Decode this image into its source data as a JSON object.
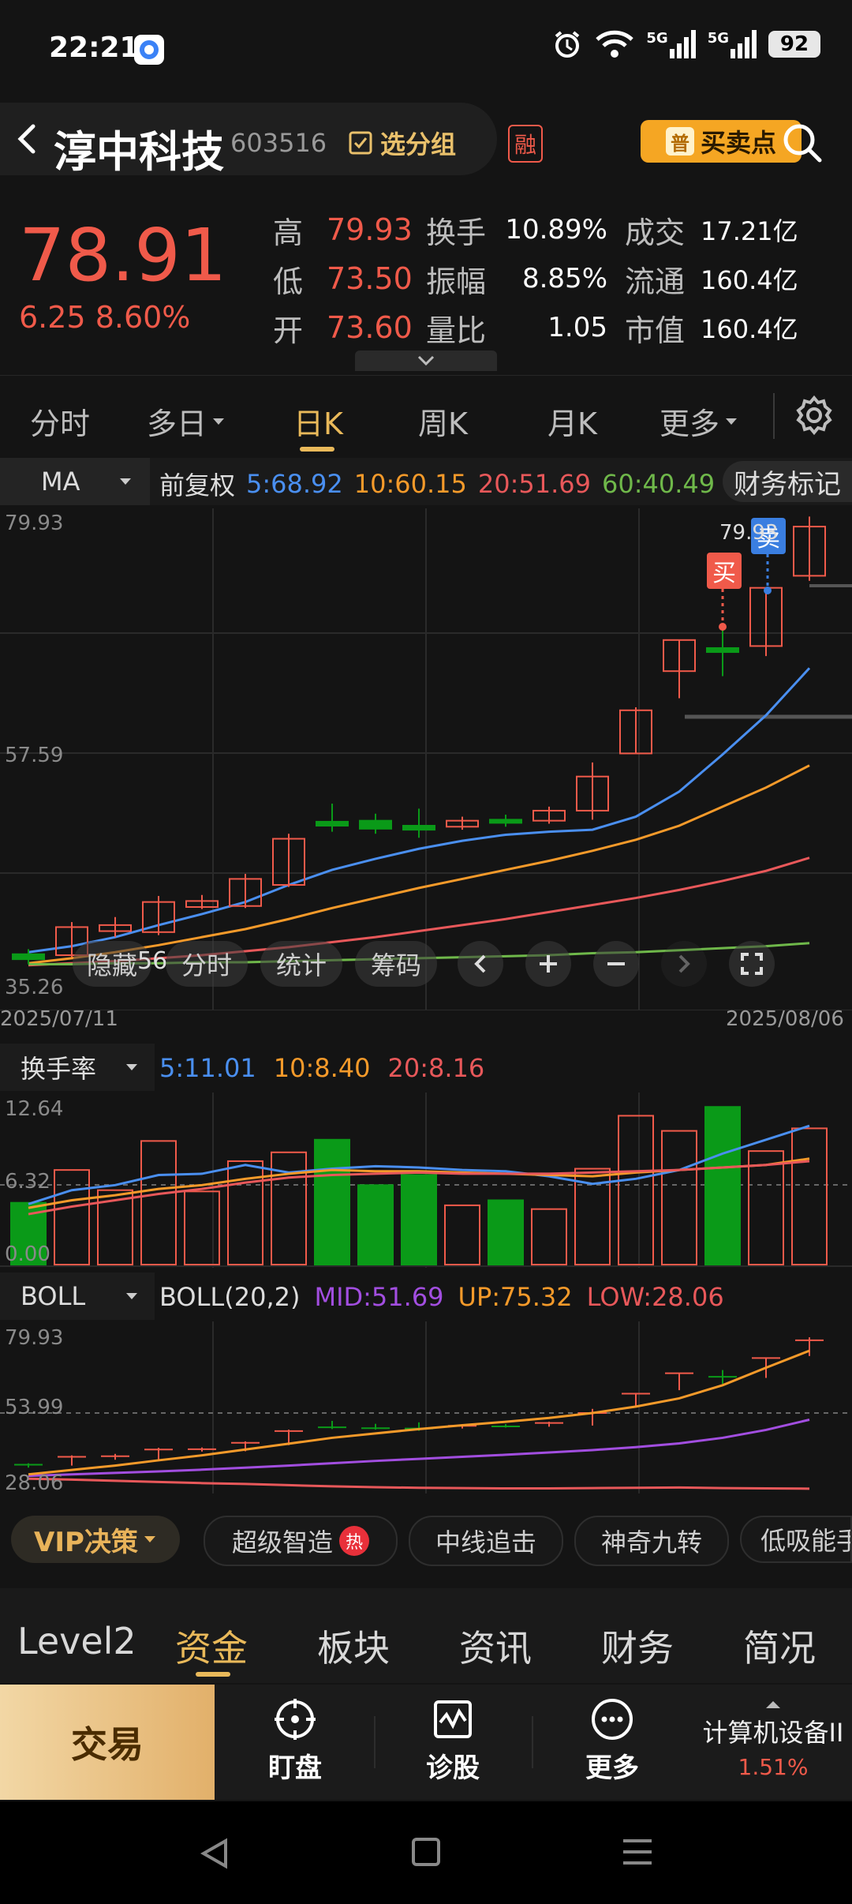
{
  "status_bar": {
    "time": "22:21",
    "network_1": "5G",
    "network_2": "5G",
    "battery": "92"
  },
  "header": {
    "stock_name": "淳中科技",
    "stock_code": "603516",
    "group_label": "选分组",
    "margin_tag": "融",
    "signal_btn_icon_text": "普",
    "signal_btn_label": "买卖点"
  },
  "quote": {
    "price": "78.91",
    "change": "6.25 8.60%",
    "rows": [
      {
        "k1": "高",
        "v1": "79.93",
        "k2": "换手",
        "v2": "10.89%",
        "k3": "成交",
        "v3": "17.21亿"
      },
      {
        "k1": "低",
        "v1": "73.50",
        "k2": "振幅",
        "v2": "8.85%",
        "k3": "流通",
        "v3": "160.4亿"
      },
      {
        "k1": "开",
        "v1": "73.60",
        "k2": "量比",
        "v2": "1.05",
        "k3": "市值",
        "v3": "160.4亿"
      }
    ]
  },
  "period_tabs": [
    {
      "label": "分时"
    },
    {
      "label": "多日"
    },
    {
      "label": "日K",
      "active": true
    },
    {
      "label": "周K"
    },
    {
      "label": "月K"
    },
    {
      "label": "更多"
    }
  ],
  "ma_bar": {
    "indicator": "MA",
    "adjust": "前复权",
    "ma5": "5:68.92",
    "ma10": "10:60.15",
    "ma20": "20:51.69",
    "ma60": "60:40.49",
    "finance_mark": "财务标记"
  },
  "colors": {
    "up": "#f05a4a",
    "down": "#0a9a18",
    "ma5": "#4a8ff0",
    "ma10": "#f59a2a",
    "ma20": "#e8585a",
    "ma60": "#6fb84a",
    "mid": "#a24ee0",
    "accent": "#e9b95a"
  },
  "kline": {
    "y_labels": {
      "top": "79.93",
      "mid": "57.59",
      "bottom": "35.26"
    },
    "date_start": "2025/07/11",
    "date_end": "2025/08/06",
    "buy_tag": "买",
    "sell_tag": "卖",
    "high_label": "79.93",
    "controls": {
      "hide": "隐藏",
      "period_num": "56",
      "intraday": "分时",
      "stats": "统计",
      "chips": "筹码"
    }
  },
  "turnover": {
    "indicator": "换手率",
    "ma5": "5:11.01",
    "ma10": "10:8.40",
    "ma20": "20:8.16",
    "y_labels": {
      "top": "12.64",
      "mid": "6.32",
      "bottom": "0.00"
    }
  },
  "boll": {
    "indicator": "BOLL",
    "params": "BOLL(20,2)",
    "mid": "MID:51.69",
    "up": "UP:75.32",
    "low": "LOW:28.06",
    "y_labels": {
      "top": "79.93",
      "mid": "53.99",
      "bottom": "28.06"
    }
  },
  "strategies": {
    "vip": "VIP决策",
    "items": [
      "超级智造",
      "中线追击",
      "神奇九转",
      "低吸能手"
    ],
    "hot_tag": "热"
  },
  "bottom_tabs": [
    {
      "label": "Level2"
    },
    {
      "label": "资金",
      "active": true
    },
    {
      "label": "板块"
    },
    {
      "label": "资讯"
    },
    {
      "label": "财务"
    },
    {
      "label": "简况"
    }
  ],
  "actions": {
    "trade": "交易",
    "watch": "盯盘",
    "diagnose": "诊股",
    "more": "更多",
    "sector_name": "计算机设备II",
    "sector_pct": "1.51%"
  },
  "chart_data": [
    {
      "type": "candlestick",
      "title": "日K",
      "x_range": [
        "2025/07/11",
        "2025/08/06"
      ],
      "ylim": [
        35.26,
        79.93
      ],
      "candles": [
        {
          "o": 35.8,
          "c": 36.3,
          "h": 36.8,
          "l": 35.3,
          "dir": "down"
        },
        {
          "o": 36.2,
          "c": 39.0,
          "h": 39.5,
          "l": 36.0,
          "dir": "up"
        },
        {
          "o": 38.6,
          "c": 39.2,
          "h": 40.0,
          "l": 38.0,
          "dir": "up"
        },
        {
          "o": 38.5,
          "c": 41.5,
          "h": 42.1,
          "l": 38.2,
          "dir": "up"
        },
        {
          "o": 41.0,
          "c": 41.6,
          "h": 42.2,
          "l": 40.8,
          "dir": "up"
        },
        {
          "o": 41.1,
          "c": 43.8,
          "h": 44.3,
          "l": 40.9,
          "dir": "up"
        },
        {
          "o": 43.2,
          "c": 47.8,
          "h": 48.3,
          "l": 43.0,
          "dir": "up"
        },
        {
          "o": 49.5,
          "c": 49.1,
          "h": 51.3,
          "l": 48.5,
          "dir": "down"
        },
        {
          "o": 49.6,
          "c": 48.8,
          "h": 50.3,
          "l": 48.3,
          "dir": "down"
        },
        {
          "o": 49.1,
          "c": 48.7,
          "h": 50.8,
          "l": 47.9,
          "dir": "down"
        },
        {
          "o": 49.0,
          "c": 49.6,
          "h": 50.0,
          "l": 48.7,
          "dir": "up"
        },
        {
          "o": 49.7,
          "c": 49.4,
          "h": 50.2,
          "l": 49.0,
          "dir": "down"
        },
        {
          "o": 49.6,
          "c": 50.6,
          "h": 51.0,
          "l": 49.3,
          "dir": "up"
        },
        {
          "o": 50.6,
          "c": 54.0,
          "h": 55.4,
          "l": 49.7,
          "dir": "up"
        },
        {
          "o": 56.3,
          "c": 60.6,
          "h": 60.9,
          "l": 56.3,
          "dir": "up"
        },
        {
          "o": 64.5,
          "c": 67.6,
          "h": 67.6,
          "l": 61.8,
          "dir": "up"
        },
        {
          "o": 66.8,
          "c": 66.4,
          "h": 68.7,
          "l": 64.0,
          "dir": "down"
        },
        {
          "o": 67.0,
          "c": 72.8,
          "h": 72.8,
          "l": 66.0,
          "dir": "up"
        },
        {
          "o": 74.0,
          "c": 78.9,
          "h": 79.9,
          "l": 73.5,
          "dir": "up"
        }
      ],
      "series": [
        {
          "name": "MA5",
          "values": [
            36.5,
            37.1,
            38.0,
            39.2,
            40.3,
            41.5,
            43.2,
            44.7,
            45.8,
            46.8,
            47.6,
            48.2,
            48.5,
            48.7,
            50.0,
            52.5,
            56.2,
            60.1,
            64.8
          ]
        },
        {
          "name": "MA10",
          "values": [
            35.4,
            35.9,
            36.5,
            37.2,
            38.0,
            38.8,
            39.8,
            40.9,
            41.9,
            42.9,
            43.8,
            44.7,
            45.6,
            46.6,
            47.7,
            49.1,
            51.0,
            52.9,
            55.1
          ]
        },
        {
          "name": "MA20",
          "values": [
            35.2,
            35.4,
            35.6,
            35.9,
            36.2,
            36.6,
            37.0,
            37.5,
            38.0,
            38.6,
            39.2,
            39.8,
            40.5,
            41.2,
            41.9,
            42.7,
            43.6,
            44.6,
            45.9
          ]
        },
        {
          "name": "MA60",
          "values": [
            35.3,
            35.3,
            35.4,
            35.4,
            35.5,
            35.5,
            35.6,
            35.7,
            35.8,
            35.9,
            36.0,
            36.1,
            36.2,
            36.4,
            36.5,
            36.7,
            36.9,
            37.1,
            37.4
          ]
        }
      ]
    },
    {
      "type": "bar",
      "title": "换手率",
      "ylim": [
        0,
        12.64
      ],
      "values": [
        4.9,
        7.5,
        5.9,
        9.8,
        5.8,
        8.2,
        8.9,
        9.9,
        6.3,
        7.1,
        4.7,
        5.1,
        4.4,
        7.6,
        11.8,
        10.6,
        12.5,
        9.0,
        10.8
      ],
      "dirs": [
        "down",
        "up",
        "up",
        "up",
        "up",
        "up",
        "up",
        "down",
        "down",
        "down",
        "up",
        "down",
        "up",
        "up",
        "up",
        "up",
        "down",
        "up",
        "up"
      ],
      "series": [
        {
          "name": "5",
          "values": [
            4.8,
            5.9,
            6.3,
            7.1,
            7.2,
            7.9,
            7.3,
            7.6,
            7.8,
            7.7,
            7.5,
            7.4,
            7.0,
            6.4,
            6.8,
            7.5,
            8.8,
            9.9,
            11.0
          ]
        },
        {
          "name": "10",
          "values": [
            4.5,
            5.1,
            5.5,
            6.0,
            6.3,
            6.8,
            7.2,
            7.5,
            7.4,
            7.4,
            7.3,
            7.2,
            7.1,
            7.0,
            7.3,
            7.5,
            7.7,
            7.9,
            8.4
          ]
        },
        {
          "name": "20",
          "values": [
            4.0,
            4.6,
            5.1,
            5.6,
            6.0,
            6.5,
            6.9,
            7.1,
            7.2,
            7.3,
            7.2,
            7.2,
            7.2,
            7.3,
            7.4,
            7.5,
            7.7,
            7.9,
            8.2
          ]
        }
      ]
    },
    {
      "type": "line",
      "title": "BOLL(20,2)",
      "ylim": [
        28.06,
        79.93
      ],
      "series": [
        {
          "name": "MID",
          "values": [
            32.5,
            33.0,
            33.5,
            34.0,
            34.6,
            35.3,
            36.0,
            36.8,
            37.6,
            38.3,
            39.0,
            39.7,
            40.5,
            41.3,
            42.3,
            43.6,
            45.5,
            48.2,
            51.7
          ]
        },
        {
          "name": "UP",
          "values": [
            33.0,
            34.5,
            36.0,
            37.8,
            39.5,
            41.5,
            43.5,
            45.5,
            47.0,
            48.5,
            49.8,
            51.0,
            52.3,
            54.0,
            56.2,
            59.0,
            63.5,
            69.5,
            75.3
          ]
        },
        {
          "name": "LOW",
          "values": [
            31.5,
            31.2,
            30.8,
            30.4,
            30.0,
            29.7,
            29.3,
            28.9,
            28.6,
            28.4,
            28.3,
            28.2,
            28.2,
            28.3,
            28.4,
            28.5,
            28.3,
            28.2,
            28.1
          ]
        }
      ]
    }
  ]
}
